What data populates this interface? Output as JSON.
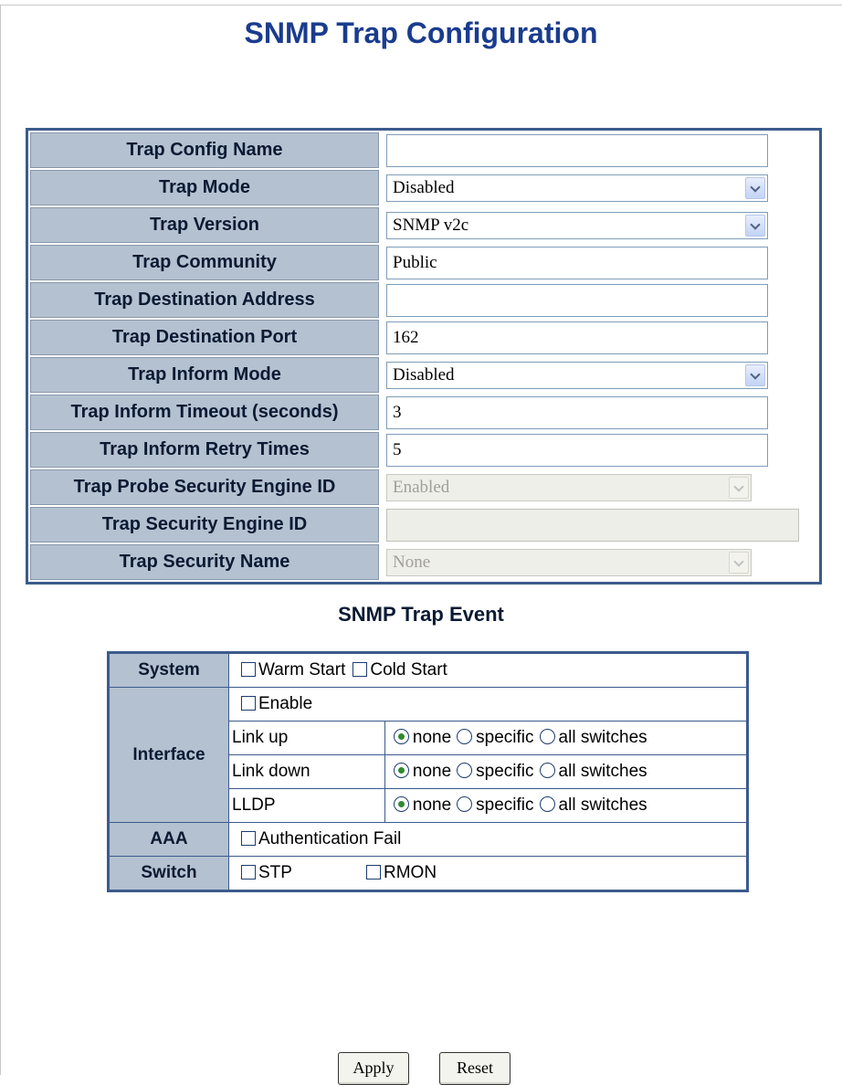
{
  "page": {
    "title": "SNMP Trap Configuration"
  },
  "config": {
    "rows": [
      {
        "label": "Trap Config Name",
        "type": "text",
        "value": ""
      },
      {
        "label": "Trap Mode",
        "type": "select",
        "value": "Disabled"
      },
      {
        "label": "Trap Version",
        "type": "select",
        "value": "SNMP v2c"
      },
      {
        "label": "Trap Community",
        "type": "text",
        "value": "Public"
      },
      {
        "label": "Trap Destination Address",
        "type": "text",
        "value": ""
      },
      {
        "label": "Trap Destination Port",
        "type": "text",
        "value": "162"
      },
      {
        "label": "Trap Inform Mode",
        "type": "select",
        "value": "Disabled"
      },
      {
        "label": "Trap Inform Timeout (seconds)",
        "type": "text",
        "value": "3"
      },
      {
        "label": "Trap Inform Retry Times",
        "type": "text",
        "value": "5"
      },
      {
        "label": "Trap Probe Security Engine ID",
        "type": "select",
        "value": "Enabled",
        "disabled": true
      },
      {
        "label": "Trap Security Engine ID",
        "type": "text",
        "value": "",
        "disabled": true
      },
      {
        "label": "Trap Security Name",
        "type": "select",
        "value": "None",
        "disabled": true
      }
    ]
  },
  "events": {
    "title": "SNMP Trap Event",
    "system": {
      "label": "System",
      "warm_start": "Warm Start",
      "warm_start_checked": false,
      "cold_start": "Cold Start",
      "cold_start_checked": false
    },
    "interface": {
      "label": "Interface",
      "enable": "Enable",
      "enable_checked": false,
      "options": {
        "none": "none",
        "specific": "specific",
        "all": "all switches"
      },
      "rows": [
        {
          "label": "Link up",
          "selected": "none"
        },
        {
          "label": "Link down",
          "selected": "none"
        },
        {
          "label": "LLDP",
          "selected": "none"
        }
      ]
    },
    "aaa": {
      "label": "AAA",
      "auth_fail": "Authentication Fail",
      "auth_fail_checked": false
    },
    "switch": {
      "label": "Switch",
      "stp": "STP",
      "stp_checked": false,
      "rmon": "RMON",
      "rmon_checked": false
    }
  },
  "buttons": {
    "apply": "Apply",
    "reset": "Reset"
  }
}
